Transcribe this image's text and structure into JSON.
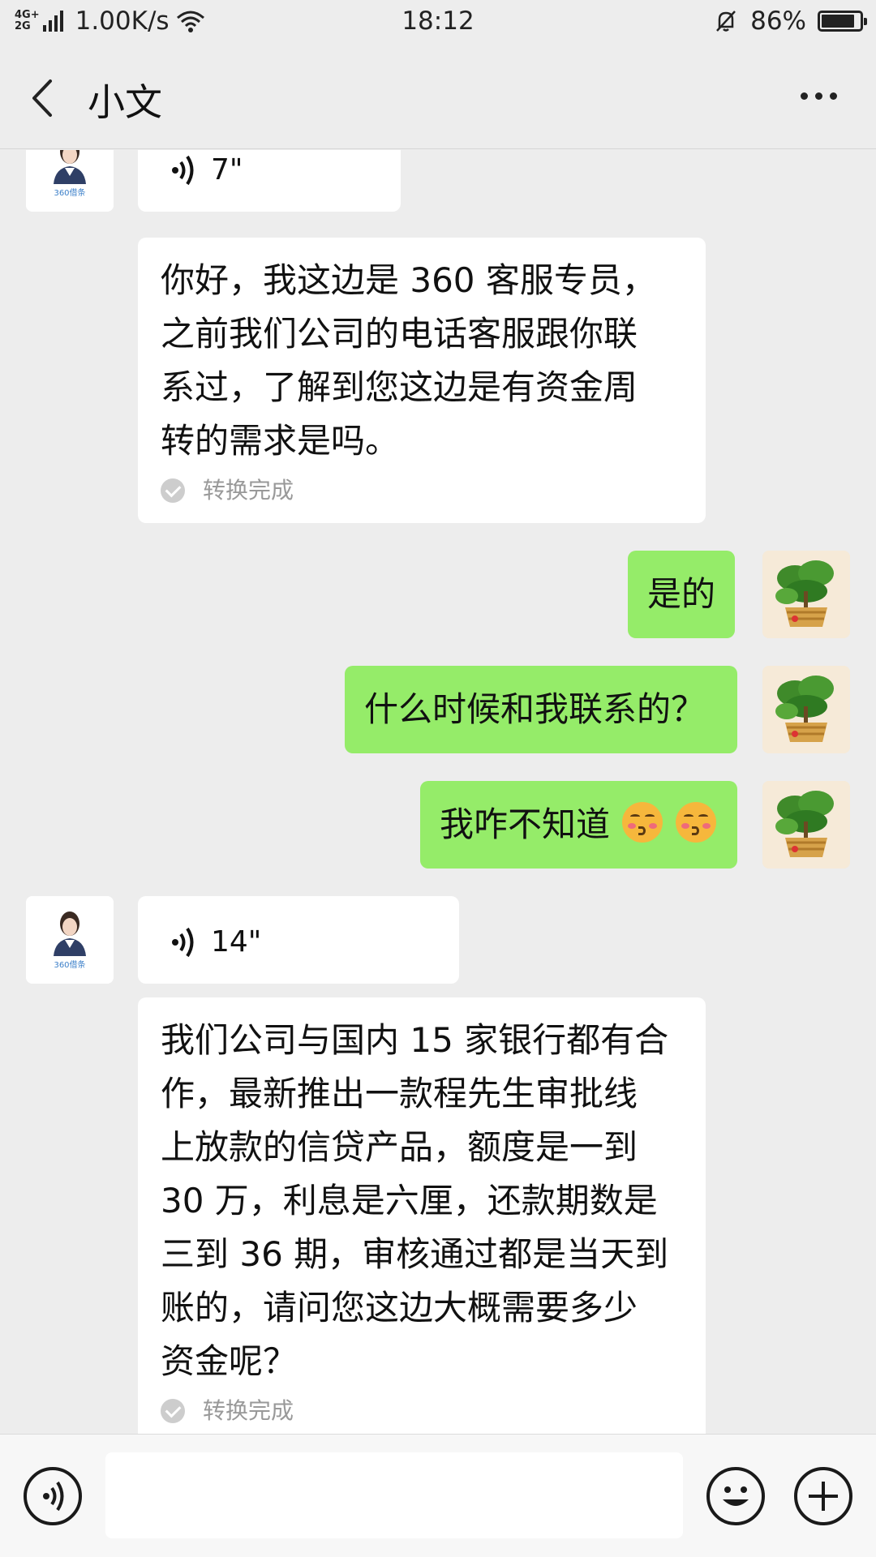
{
  "status_bar": {
    "network_top": "4G+",
    "network_bottom": "2G",
    "speed": "1.00K/s",
    "time": "18:12",
    "battery": "86%",
    "battery_level": 0.86
  },
  "header": {
    "title": "小文",
    "back_icon": "chevron-left-icon",
    "more_icon": "more-dots-icon"
  },
  "messages": [
    {
      "from": "agent",
      "type": "voice",
      "duration": "7\""
    },
    {
      "from": "agent",
      "type": "transcript",
      "lines": [
        "你好，我这边是 360 客服专员，",
        "之前我们公司的电话客服跟你联",
        "系过，了解到您这边是有资金周",
        "转的需求是吗。"
      ],
      "status": "转换完成"
    },
    {
      "from": "me",
      "type": "text",
      "text": "是的"
    },
    {
      "from": "me",
      "type": "text",
      "text": "什么时候和我联系的？"
    },
    {
      "from": "me",
      "type": "text",
      "text": "我咋不知道",
      "emoji": "kissing-face-emoji"
    },
    {
      "from": "agent",
      "type": "voice",
      "duration": "14\""
    },
    {
      "from": "agent",
      "type": "transcript",
      "lines": [
        "我们公司与国内 15 家银行都有合",
        "作，最新推出一款程先生审批线",
        "上放款的信贷产品，额度是一到",
        "30 万，利息是六厘，还款期数是",
        "三到 36 期，审核通过都是当天到",
        "账的，请问您这边大概需要多少",
        "资金呢？"
      ],
      "status": "转换完成"
    }
  ],
  "avatars": {
    "agent_logo_text": "360借条"
  },
  "bottom_bar": {
    "voice_icon": "voice-input-icon",
    "emoji_icon": "emoji-icon",
    "plus_icon": "plus-icon",
    "input_value": ""
  }
}
